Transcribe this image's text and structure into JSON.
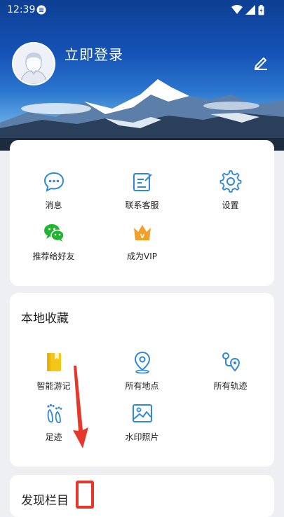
{
  "status_bar": {
    "time": "12:39"
  },
  "profile": {
    "login_label": "立即登录"
  },
  "quick_menu": {
    "items": [
      {
        "label": "消息",
        "icon": "message-icon"
      },
      {
        "label": "联系客服",
        "icon": "contact-service-icon"
      },
      {
        "label": "设置",
        "icon": "gear-icon"
      },
      {
        "label": "推荐给好友",
        "icon": "wechat-icon"
      },
      {
        "label": "成为VIP",
        "icon": "vip-crown-icon"
      }
    ]
  },
  "local_collection": {
    "title": "本地收藏",
    "items": [
      {
        "label": "智能游记",
        "icon": "travel-note-icon"
      },
      {
        "label": "所有地点",
        "icon": "location-pin-icon"
      },
      {
        "label": "所有轨迹",
        "icon": "track-route-icon"
      },
      {
        "label": "足迹",
        "icon": "footprint-icon"
      },
      {
        "label": "水印照片",
        "icon": "watermark-photo-icon"
      }
    ]
  },
  "discover": {
    "title": "发现栏目"
  },
  "colors": {
    "accent": "#2f88d8",
    "wechat": "#1fb52f",
    "vip": "#f1a12a",
    "travel_note": "#f5c518",
    "annotation": "#e6372b"
  }
}
